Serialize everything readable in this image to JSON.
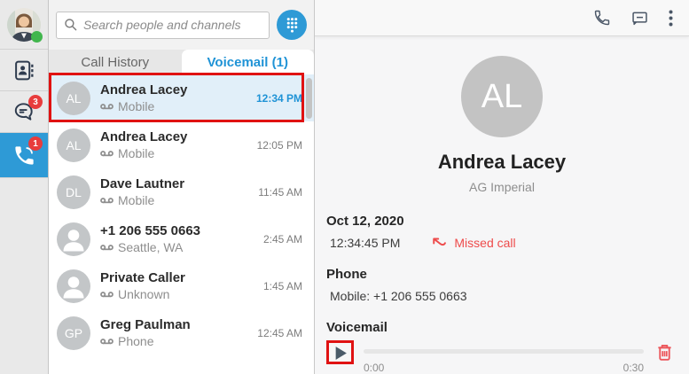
{
  "sidebar": {
    "chat_badge": "3",
    "phone_badge": "1"
  },
  "search": {
    "placeholder": "Search people and channels"
  },
  "tabs": [
    {
      "label": "Call History"
    },
    {
      "label": "Voicemail (1)"
    }
  ],
  "call_list": {
    "items": [
      {
        "avatar": "initials",
        "initials": "AL",
        "name": "Andrea Lacey",
        "subtitle": "Mobile",
        "time": "12:34 PM",
        "selected": true,
        "annotated": true
      },
      {
        "avatar": "initials",
        "initials": "AL",
        "name": "Andrea Lacey",
        "subtitle": "Mobile",
        "time": "12:05 PM"
      },
      {
        "avatar": "initials",
        "initials": "DL",
        "name": "Dave Lautner",
        "subtitle": "Mobile",
        "time": "11:45 AM"
      },
      {
        "avatar": "person",
        "initials": "",
        "name": "+1 206 555 0663",
        "subtitle": "Seattle, WA",
        "time": "2:45 AM"
      },
      {
        "avatar": "person",
        "initials": "",
        "name": "Private Caller",
        "subtitle": "Unknown",
        "time": "1:45 AM"
      },
      {
        "avatar": "initials",
        "initials": "GP",
        "name": "Greg Paulman",
        "subtitle": "Phone",
        "time": "12:45 AM"
      }
    ]
  },
  "detail": {
    "initials": "AL",
    "name": "Andrea Lacey",
    "company": "AG Imperial",
    "date": "Oct 12, 2020",
    "time": "12:34:45 PM",
    "call_status": "Missed call",
    "phone_label": "Phone",
    "phone_value": "Mobile: +1 206 555 0663",
    "voicemail_label": "Voicemail",
    "player": {
      "elapsed": "0:00",
      "duration": "0:30"
    }
  },
  "colors": {
    "accent_blue": "#2e9ad6",
    "selection_blue": "#e1eff9",
    "annotation_red": "#e01212",
    "missed_red": "#ee4b4b",
    "badge_red": "#e83c3c",
    "trash_red": "#ec575b",
    "presence_green": "#41b64d"
  }
}
